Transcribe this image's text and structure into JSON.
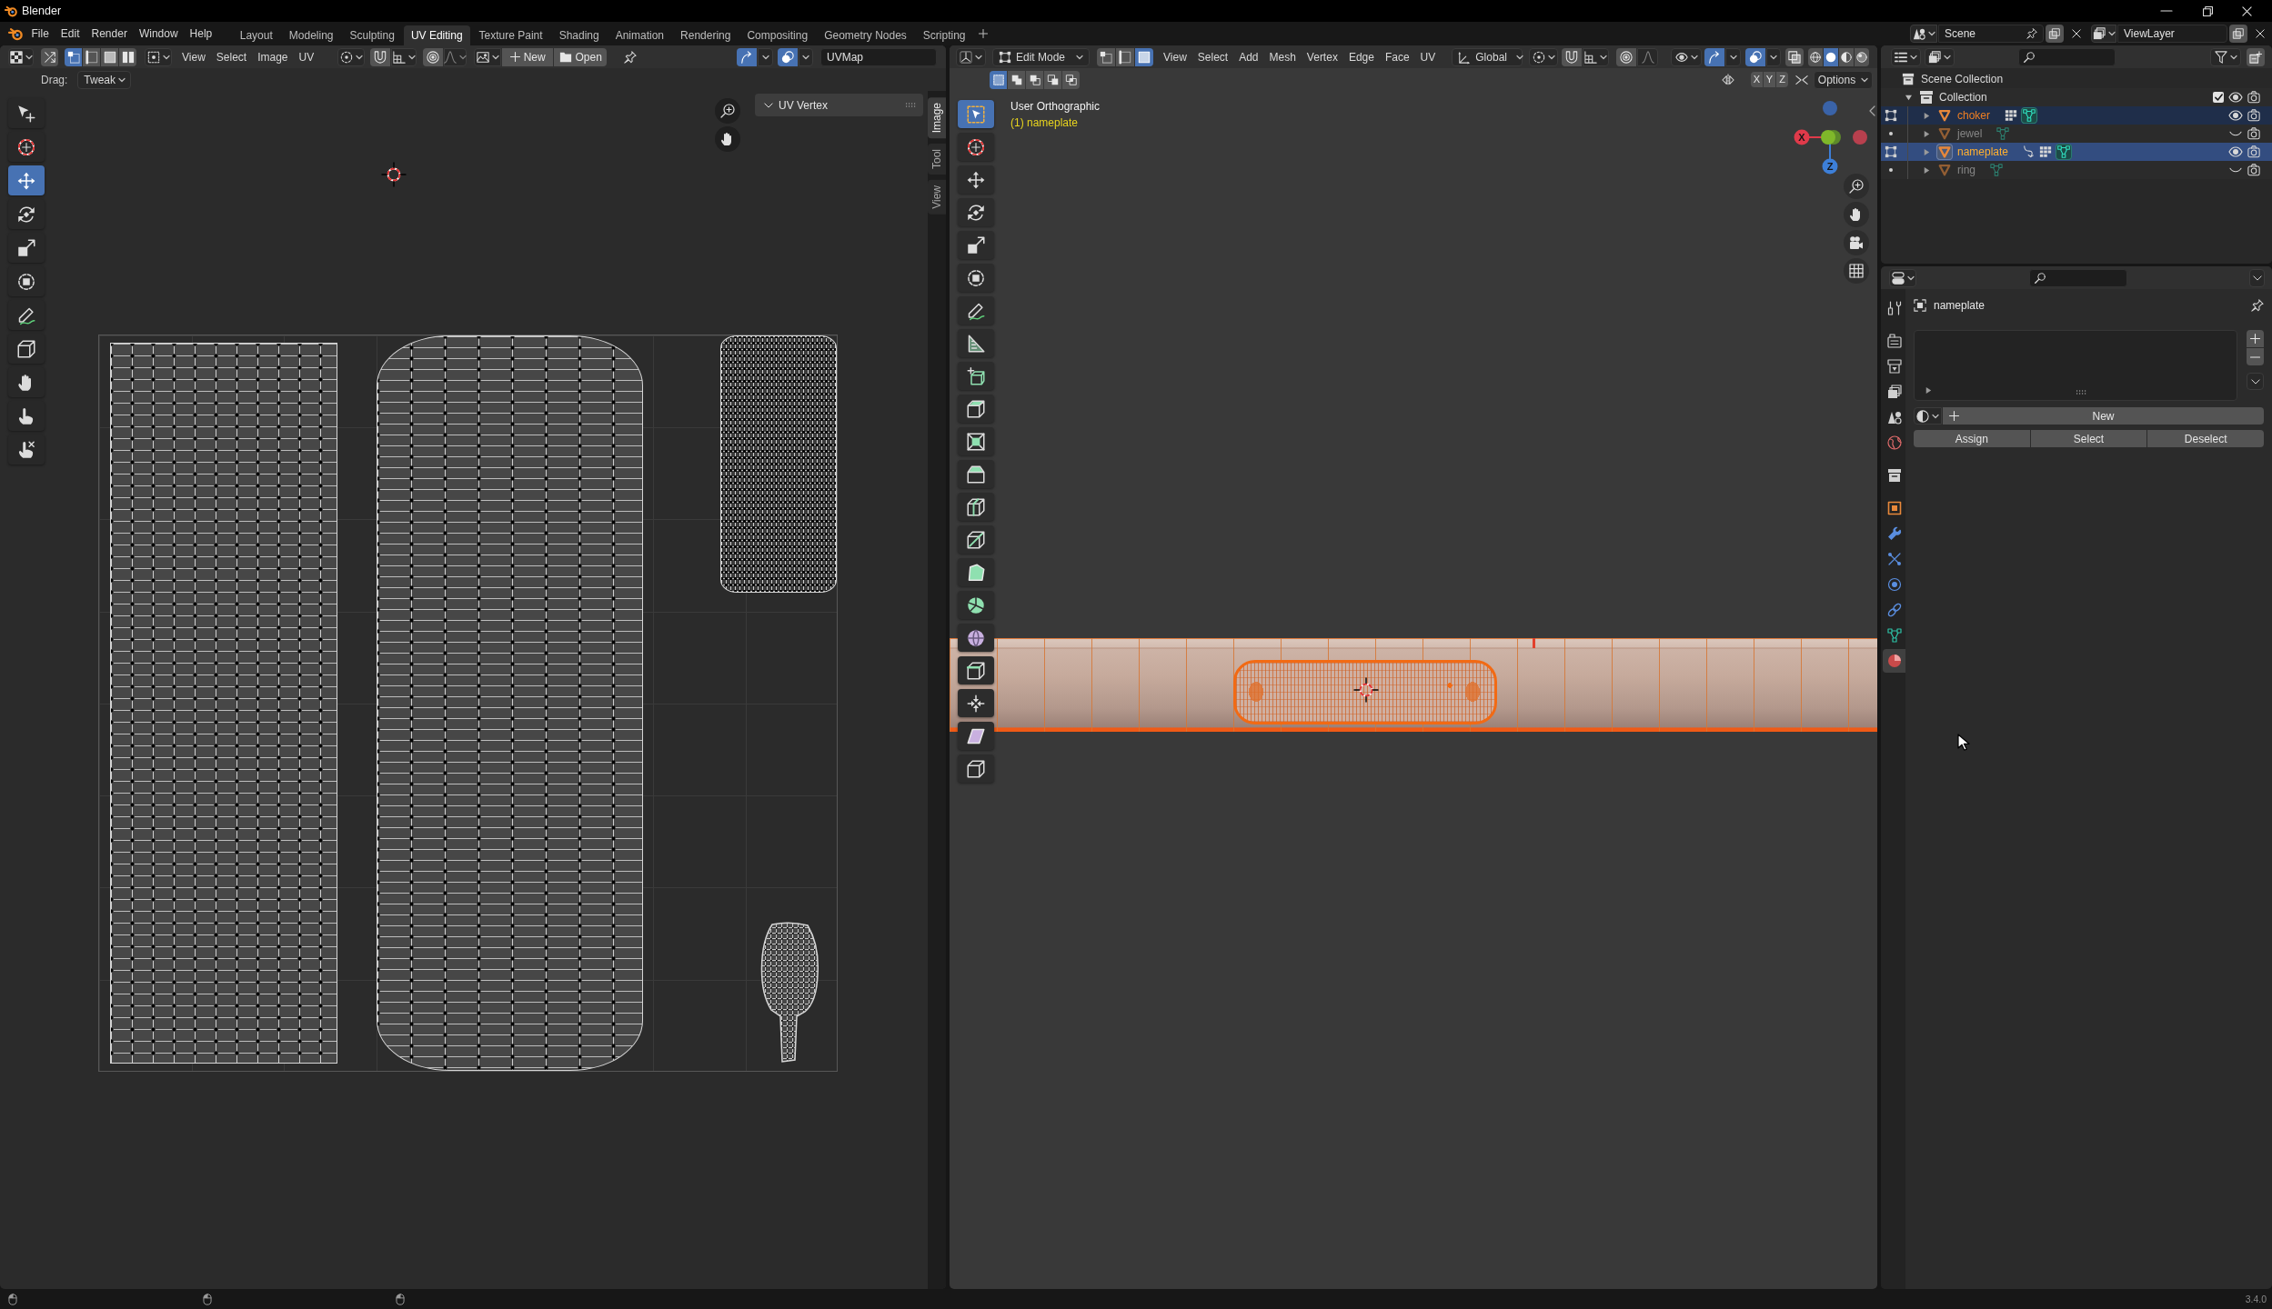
{
  "window": {
    "title": "Blender"
  },
  "top_bar": {
    "menus": [
      "File",
      "Edit",
      "Render",
      "Window",
      "Help"
    ],
    "workspaces": [
      {
        "label": "Layout",
        "selected": false
      },
      {
        "label": "Modeling",
        "selected": false
      },
      {
        "label": "Sculpting",
        "selected": false
      },
      {
        "label": "UV Editing",
        "selected": true
      },
      {
        "label": "Texture Paint",
        "selected": false
      },
      {
        "label": "Shading",
        "selected": false
      },
      {
        "label": "Animation",
        "selected": false
      },
      {
        "label": "Rendering",
        "selected": false
      },
      {
        "label": "Compositing",
        "selected": false
      },
      {
        "label": "Geometry Nodes",
        "selected": false
      },
      {
        "label": "Scripting",
        "selected": false
      }
    ],
    "scene": "Scene",
    "view_layer": "ViewLayer"
  },
  "uv_editor": {
    "header": {
      "sync_selection": false,
      "select_modes": [
        {
          "kind": "vertex",
          "selected": true
        },
        {
          "kind": "edge",
          "selected": false
        },
        {
          "kind": "face",
          "selected": false
        },
        {
          "kind": "island",
          "selected": false
        }
      ],
      "menus": [
        "View",
        "Select",
        "Image",
        "UV"
      ],
      "snap": false,
      "proportional": false,
      "new_button": "New",
      "open_button": "Open",
      "gizmos": true,
      "overlays": true,
      "uv_map": "UVMap"
    },
    "tool_settings": {
      "label": "Drag:",
      "value": "Tweak"
    },
    "tools": [
      {
        "kind": "tweak",
        "selected": false
      },
      {
        "kind": "cursor",
        "selected": false
      },
      {
        "kind": "move",
        "selected": true
      },
      {
        "kind": "rotate",
        "selected": false
      },
      {
        "kind": "scale",
        "selected": false
      },
      {
        "kind": "transform",
        "selected": false
      },
      {
        "kind": "annotate",
        "selected": false
      },
      {
        "kind": "rip",
        "selected": false
      },
      {
        "kind": "grab",
        "selected": false
      },
      {
        "kind": "relax",
        "selected": false
      },
      {
        "kind": "pinch",
        "selected": false
      }
    ],
    "sidebar": {
      "panel": {
        "title": "UV Vertex",
        "expanded": true
      },
      "tabs": [
        {
          "label": "Image",
          "selected": true
        },
        {
          "label": "Tool",
          "selected": false
        },
        {
          "label": "View",
          "selected": false
        }
      ]
    }
  },
  "viewport": {
    "header": {
      "mode": "Edit Mode",
      "select_modes": [
        {
          "kind": "vertex",
          "selected": false
        },
        {
          "kind": "edge",
          "selected": false
        },
        {
          "kind": "face",
          "selected": true
        }
      ],
      "menus": [
        "View",
        "Select",
        "Add",
        "Mesh",
        "Vertex",
        "Edge",
        "Face",
        "UV"
      ],
      "orientation": "Global",
      "snap": false,
      "proportional": false,
      "gizmos": true,
      "overlays": true,
      "xray": false,
      "shading_modes": [
        {
          "kind": "wireframe",
          "selected": false
        },
        {
          "kind": "solid",
          "selected": true
        },
        {
          "kind": "material",
          "selected": false
        },
        {
          "kind": "rendered",
          "selected": false
        }
      ]
    },
    "tool_settings": {
      "box_modes": [
        {
          "kind": "set",
          "selected": true
        },
        {
          "kind": "extend",
          "selected": false
        },
        {
          "kind": "subtract",
          "selected": false
        },
        {
          "kind": "invert",
          "selected": false
        },
        {
          "kind": "intersect",
          "selected": false
        }
      ],
      "mirror_axes": [
        {
          "label": "X",
          "selected": false
        },
        {
          "label": "Y",
          "selected": false
        },
        {
          "label": "Z",
          "selected": false
        }
      ],
      "options": "Options"
    },
    "tools": [
      {
        "kind": "select",
        "selected": true
      },
      {
        "kind": "cursor",
        "selected": false
      },
      {
        "kind": "move",
        "selected": false
      },
      {
        "kind": "rotate",
        "selected": false
      },
      {
        "kind": "scale",
        "selected": false
      },
      {
        "kind": "transform",
        "selected": false
      },
      {
        "kind": "annotate",
        "selected": false
      },
      {
        "kind": "measure",
        "selected": false
      },
      {
        "kind": "addcube",
        "selected": false
      },
      {
        "kind": "extrude",
        "selected": false
      },
      {
        "kind": "inset",
        "selected": false
      },
      {
        "kind": "bevel",
        "selected": false
      },
      {
        "kind": "loopcut",
        "selected": false
      },
      {
        "kind": "knife",
        "selected": false
      },
      {
        "kind": "polybuild",
        "selected": false
      },
      {
        "kind": "spin",
        "selected": false
      },
      {
        "kind": "smooth",
        "selected": false
      },
      {
        "kind": "edgeslide",
        "selected": false
      },
      {
        "kind": "shrink",
        "selected": false
      },
      {
        "kind": "shear",
        "selected": false
      },
      {
        "kind": "rip",
        "selected": false
      }
    ],
    "view_name": "User Orthographic",
    "object_label": "(1) nameplate",
    "gizmo": {
      "x_label": "X",
      "z_label": "Z"
    }
  },
  "outliner": {
    "root": "Scene Collection",
    "collections": [
      {
        "name": "Collection",
        "expanded": true,
        "checked": true,
        "children": [
          {
            "name": "choker",
            "expanded": false,
            "selected": true,
            "active": false,
            "visible": true,
            "editing": true,
            "badges": [
              {
                "kind": "modifiers"
              },
              {
                "kind": "mesh"
              }
            ]
          },
          {
            "name": "jewel",
            "expanded": false,
            "selected": false,
            "active": false,
            "visible": false,
            "editing": false,
            "badges": [
              {
                "kind": "mesh"
              }
            ]
          },
          {
            "name": "nameplate",
            "expanded": false,
            "selected": true,
            "active": true,
            "visible": true,
            "editing": true,
            "badges": [
              {
                "kind": "constraint"
              },
              {
                "kind": "modifiers"
              },
              {
                "kind": "mesh"
              }
            ]
          },
          {
            "name": "ring",
            "expanded": false,
            "selected": false,
            "active": false,
            "visible": false,
            "editing": false,
            "badges": [
              {
                "kind": "mesh"
              }
            ]
          }
        ]
      }
    ]
  },
  "properties": {
    "tabs": [
      {
        "kind": "tool",
        "selected": false
      },
      {
        "kind": "render",
        "selected": false
      },
      {
        "kind": "output",
        "selected": false
      },
      {
        "kind": "viewlayer",
        "selected": false
      },
      {
        "kind": "scene",
        "selected": false
      },
      {
        "kind": "world",
        "selected": false
      },
      {
        "kind": "collection",
        "selected": false
      },
      {
        "kind": "object",
        "selected": false
      },
      {
        "kind": "modifiers",
        "selected": false
      },
      {
        "kind": "particles",
        "selected": false
      },
      {
        "kind": "physics",
        "selected": false
      },
      {
        "kind": "constraints",
        "selected": false
      },
      {
        "kind": "data",
        "selected": false
      },
      {
        "kind": "material",
        "selected": true
      }
    ],
    "object_name": "nameplate",
    "new_button": "New",
    "slot_buttons": [
      "Assign",
      "Select",
      "Deselect"
    ]
  },
  "status_bar": {
    "version": "3.4.0"
  }
}
